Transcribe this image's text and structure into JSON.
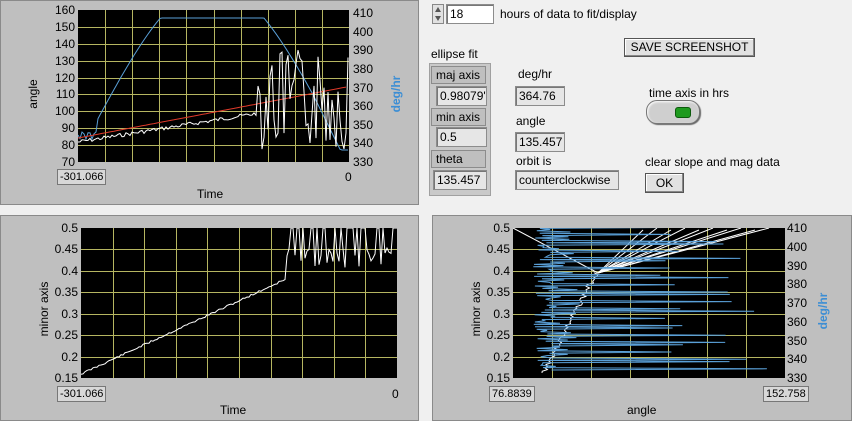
{
  "controls": {
    "hours": {
      "value": "18",
      "label": "hours of data to fit/display"
    },
    "save_button": "SAVE SCREENSHOT",
    "ellipse_fit_label": "ellipse fit",
    "maj_axis": {
      "label": "maj axis",
      "value": "0.98079'"
    },
    "min_axis": {
      "label": "min axis",
      "value": "0.5"
    },
    "theta": {
      "label": "theta",
      "value": "135.457"
    },
    "deg_hr": {
      "label": "deg/hr",
      "value": "364.76"
    },
    "angle": {
      "label": "angle",
      "value": "135.457"
    },
    "orbit": {
      "label": "orbit is",
      "value": "counterclockwise"
    },
    "time_axis": {
      "label": "time axis in hrs",
      "state": "on"
    },
    "clear": {
      "label": "clear slope and mag data",
      "button": "OK"
    }
  },
  "charts": {
    "top_left": {
      "ylabel": "angle",
      "y2label": "deg/hr",
      "xlabel": "Time",
      "yticks": [
        "160",
        "150",
        "140",
        "130",
        "120",
        "110",
        "100",
        "90",
        "80",
        "70"
      ],
      "y2ticks": [
        "410",
        "400",
        "390",
        "380",
        "370",
        "360",
        "350",
        "340",
        "330"
      ],
      "xmin": "-301.066",
      "xmax": "0"
    },
    "bottom_left": {
      "ylabel": "minor axis",
      "xlabel": "Time",
      "yticks": [
        "0.5",
        "0.45",
        "0.4",
        "0.35",
        "0.3",
        "0.25",
        "0.2",
        "0.15"
      ],
      "xmin": "-301.066",
      "xmax": "0"
    },
    "bottom_right": {
      "ylabel": "minor axis",
      "y2label": "deg/hr",
      "xlabel": "angle",
      "yticks": [
        "0.5",
        "0.45",
        "0.4",
        "0.35",
        "0.3",
        "0.25",
        "0.2",
        "0.15"
      ],
      "y2ticks": [
        "410",
        "400",
        "390",
        "380",
        "370",
        "360",
        "350",
        "340",
        "330"
      ],
      "xmin": "76.8839",
      "xmax": "152.758"
    }
  },
  "colors": {
    "grid": "#b5b561",
    "trace_white": "#ffffff",
    "trace_blue": "#5aa0d8",
    "trace_red": "#e03a2a",
    "axis_label_blue": "#3c8ed4"
  }
}
